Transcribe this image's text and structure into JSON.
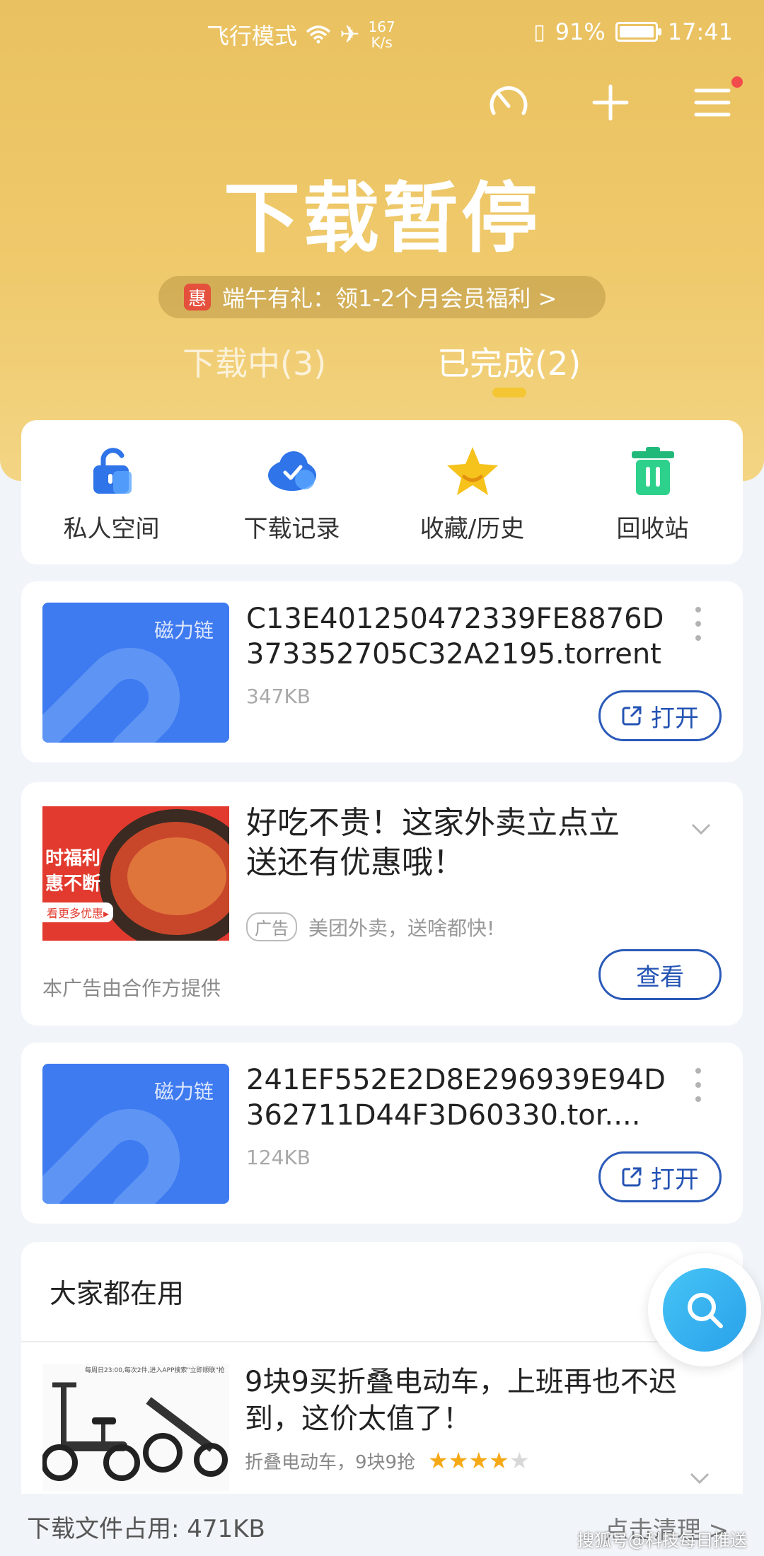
{
  "status_bar": {
    "carrier": "飞行模式",
    "speed_value": "167",
    "speed_unit": "K/s",
    "battery": "91%",
    "time": "17:41"
  },
  "hero": {
    "title": "下载暂停",
    "promo_badge": "惠",
    "promo_text": "端午有礼：领1-2个月会员福利 >",
    "tabs": [
      {
        "label": "下载中(3)"
      },
      {
        "label": "已完成(2)"
      }
    ]
  },
  "quick_actions": [
    {
      "label": "私人空间",
      "icon": "lock-icon",
      "color": "#2f74e8"
    },
    {
      "label": "下载记录",
      "icon": "cloud-check-icon",
      "color": "#2f74e8"
    },
    {
      "label": "收藏/历史",
      "icon": "star-icon",
      "color": "#f2b51b"
    },
    {
      "label": "回收站",
      "icon": "trash-icon",
      "color": "#21b97a"
    }
  ],
  "files": [
    {
      "thumb_tag": "磁力链",
      "name": "C13E401250472339FE8876D373352705C32A2195.torrent",
      "size": "347KB",
      "open_label": "打开"
    },
    {
      "thumb_tag": "磁力链",
      "name": "241EF552E2D8E296939E94D362711D44F3D60330.tor....",
      "size": "124KB",
      "open_label": "打开"
    }
  ],
  "ad": {
    "thumb_line1": "时福利",
    "thumb_line2": "惠不断",
    "thumb_line3": "看更多优惠▸",
    "title": "好吃不贵！这家外卖立点立送还有优惠哦！",
    "badge": "广告",
    "source": "美团外卖，送啥都快!",
    "provider_note": "本广告由合作方提供",
    "view_label": "查看"
  },
  "popular": {
    "heading": "大家都在用",
    "thumb_caption": "每周日23:00,每次2件,进入APP搜索\"立即顺联\"抢",
    "title": "9块9买折叠电动车，上班再也不迟到，这价太值了！",
    "meta": "折叠电动车，9块9抢",
    "rating": 4,
    "rating_max": 5
  },
  "footer": {
    "usage": "下载文件占用: 471KB",
    "clean_label": "点击清理 >",
    "watermark": "搜狐号@科技每日推送"
  },
  "colors": {
    "hero_gold": "#efc96b",
    "button_blue": "#2b5ab8",
    "thumb_blue": "#3e7af0",
    "tab_underline": "#f4c633"
  }
}
